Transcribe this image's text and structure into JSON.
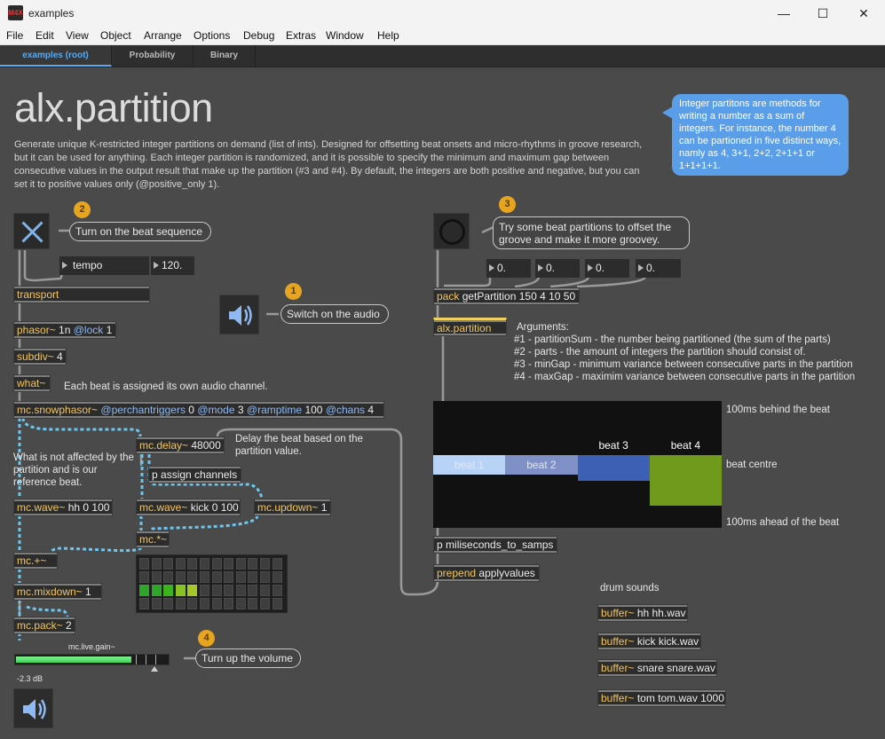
{
  "window": {
    "title": "examples",
    "app_icon": "M4X",
    "minimize": "—",
    "maximize": "☐",
    "close": "✕"
  },
  "menu": [
    "File",
    "Edit",
    "View",
    "Object",
    "Arrange",
    "Options",
    "Debug",
    "Extras",
    "Window",
    "Help"
  ],
  "tabs": [
    {
      "label": "examples (root)",
      "active": true
    },
    {
      "label": "Probability",
      "active": false
    },
    {
      "label": "Binary",
      "active": false
    }
  ],
  "patch": {
    "title": "alx.partition",
    "description": "Generate unique K-restricted integer partitions on demand (list of ints). Designed for offsetting beat onsets and micro-rhythms in groove research, but it can be used for anything. Each integer partition is randomized, and it is possible to specify the minimum and maximum gap between consecutive values in the output result that make up the partition (#3 and #4). By default, the integers are both positive and negative, but you can set it to positive values only (@positive_only 1).",
    "info_bubble": "Integer partitons are methods for writing a number as a sum of integers. For instance, the number 4 can be partioned in five distinct ways, namly as 4, 3+1, 2+2, 2+1+1 or 1+1+1+1.",
    "badges": [
      "1",
      "2",
      "3",
      "4"
    ],
    "callouts": {
      "beat_sequence": "Turn on the beat sequence",
      "audio": "Switch on the audio",
      "groove": "Try some beat partitions to offset the groove and make it more groovey.",
      "volume": "Turn up the volume"
    },
    "comments": {
      "channel": "Each beat is assigned its own audio channel.",
      "delay": "Delay the beat based on the partition value.",
      "reference": "What is not affected by the partition and is our reference beat.",
      "args_title": "Arguments:",
      "args": [
        "#1 - partitionSum -  the number being partitioned (the sum of the parts)",
        "#2 - parts - the amount of integers the partition should consist of.",
        "#3 - minGap - minimum variance between consecutive parts in the partition",
        "#4 - maxGap - maximim variance between consecutive parts in the partition"
      ],
      "behind": "100ms behind the beat",
      "centre": "beat centre",
      "ahead": "100ms ahead of the beat",
      "drums": "drum sounds",
      "gain_label": "mc.live.gain~",
      "gain_db": "-2.3 dB"
    },
    "tempo": {
      "label": "tempo",
      "value": "120."
    },
    "number_boxes": [
      "0.",
      "0.",
      "0.",
      "0."
    ],
    "objects": {
      "transport": {
        "name": "transport",
        "args": ""
      },
      "phasor": {
        "name": "phasor~",
        "args": "1n",
        "attr": "@lock",
        "attr_val": "1"
      },
      "subdiv": {
        "name": "subdiv~",
        "args": "4"
      },
      "what": {
        "name": "what~",
        "args": ""
      },
      "snowphasor": {
        "name": "mc.snowphasor~",
        "a1": "@perchantriggers",
        "v1": "0",
        "a2": "@mode",
        "v2": "3",
        "a3": "@ramptime",
        "v3": "100",
        "a4": "@chans",
        "v4": "4"
      },
      "delay": {
        "name": "mc.delay~",
        "args": "48000"
      },
      "assign": {
        "name": "p",
        "args": "assign channels"
      },
      "wave_hh": {
        "name": "mc.wave~",
        "args": "hh 0 100"
      },
      "wave_kick": {
        "name": "mc.wave~",
        "args": "kick 0 100"
      },
      "updown": {
        "name": "mc.updown~",
        "args": "1"
      },
      "mult": {
        "name": "mc.*~",
        "args": ""
      },
      "plus": {
        "name": "mc.+~",
        "args": ""
      },
      "mixdown": {
        "name": "mc.mixdown~",
        "args": "1"
      },
      "pack": {
        "name": "mc.pack~",
        "args": "2"
      },
      "pack_msg": {
        "name": "pack",
        "args": "getPartition 150 4 10 50"
      },
      "partition": {
        "name": "alx.partition",
        "args": ""
      },
      "ms_to_samps": {
        "name": "p",
        "args": "miliseconds_to_samps"
      },
      "prepend": {
        "name": "prepend",
        "args": "applyvalues"
      },
      "buf_hh": {
        "name": "buffer~",
        "args": "hh hh.wav"
      },
      "buf_kick": {
        "name": "buffer~",
        "args": "kick kick.wav"
      },
      "buf_snare": {
        "name": "buffer~",
        "args": "snare snare.wav"
      },
      "buf_tom": {
        "name": "buffer~",
        "args": "tom tom.wav 1000"
      }
    }
  },
  "chart_data": {
    "type": "bar",
    "categories": [
      "beat 1",
      "beat 2",
      "beat 3",
      "beat 4"
    ],
    "values": [
      0,
      0,
      -10,
      -50
    ],
    "ylim": [
      -100,
      100
    ],
    "ylabel_top": "100ms behind the beat",
    "ylabel_mid": "beat centre",
    "ylabel_bottom": "100ms ahead of the beat",
    "colors": [
      "#b9d3f6",
      "#7f90c6",
      "#3d60b5",
      "#6f9a1b"
    ]
  },
  "meter": {
    "level": 0.75,
    "colors": {
      "fill": "#3fd35a"
    }
  },
  "matrix": {
    "rows": 4,
    "cols": 12,
    "active_row": 2,
    "active": [
      {
        "col": 0,
        "color": "#2fa52a"
      },
      {
        "col": 1,
        "color": "#2fa52a"
      },
      {
        "col": 2,
        "color": "#3cb21f"
      },
      {
        "col": 3,
        "color": "#89c223"
      },
      {
        "col": 4,
        "color": "#a5c72a"
      }
    ]
  },
  "icons": {
    "toggle": "toggle-x-icon",
    "bang": "bang-icon",
    "speaker": "speaker-icon"
  }
}
